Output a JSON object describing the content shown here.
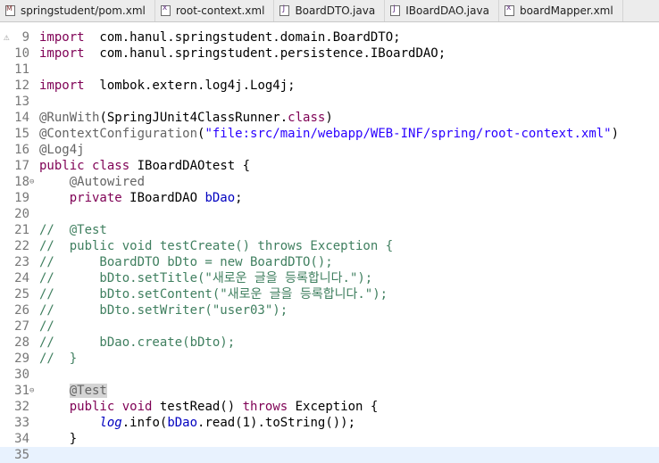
{
  "tabs": [
    {
      "label": "springstudent/pom.xml",
      "icon": "maven-pom-icon",
      "kind": "pom"
    },
    {
      "label": "root-context.xml",
      "icon": "xml-file-icon",
      "kind": "xml"
    },
    {
      "label": "BoardDTO.java",
      "icon": "java-file-icon",
      "kind": "java"
    },
    {
      "label": "IBoardDAO.java",
      "icon": "java-file-icon",
      "kind": "java"
    },
    {
      "label": "boardMapper.xml",
      "icon": "xml-file-icon",
      "kind": "xml"
    }
  ],
  "lines": [
    {
      "n": "9",
      "warn": true,
      "segs": [
        [
          "kw",
          "import"
        ],
        [
          "",
          "  com.hanul.springstudent.domain.BoardDTO;"
        ]
      ]
    },
    {
      "n": "10",
      "segs": [
        [
          "kw",
          "import"
        ],
        [
          "",
          "  com.hanul.springstudent.persistence.IBoardDAO;"
        ]
      ]
    },
    {
      "n": "11",
      "segs": []
    },
    {
      "n": "12",
      "segs": [
        [
          "kw",
          "import"
        ],
        [
          "",
          "  lombok.extern.log4j.Log4j;"
        ]
      ]
    },
    {
      "n": "13",
      "segs": []
    },
    {
      "n": "14",
      "segs": [
        [
          "an",
          "@RunWith"
        ],
        [
          "",
          "(SpringJUnit4ClassRunner."
        ],
        [
          "kw",
          "class"
        ],
        [
          "",
          ")"
        ]
      ]
    },
    {
      "n": "15",
      "segs": [
        [
          "an",
          "@ContextConfiguration"
        ],
        [
          "",
          "("
        ],
        [
          "st",
          "\"file:src/main/webapp/WEB-INF/spring/root-context.xml\""
        ],
        [
          "",
          ")"
        ]
      ]
    },
    {
      "n": "16",
      "segs": [
        [
          "an",
          "@Log4j"
        ]
      ]
    },
    {
      "n": "17",
      "segs": [
        [
          "kw",
          "public"
        ],
        [
          "",
          " "
        ],
        [
          "kw",
          "class"
        ],
        [
          "",
          " IBoardDAOtest {"
        ]
      ]
    },
    {
      "n": "18",
      "fold": true,
      "segs": [
        [
          "",
          "    "
        ],
        [
          "an",
          "@Autowired"
        ]
      ]
    },
    {
      "n": "19",
      "segs": [
        [
          "",
          "    "
        ],
        [
          "kw",
          "private"
        ],
        [
          "",
          " IBoardDAO "
        ],
        [
          "fd",
          "bDao"
        ],
        [
          "",
          ";"
        ]
      ]
    },
    {
      "n": "20",
      "segs": []
    },
    {
      "n": "21",
      "segs": [
        [
          "cm",
          "//  @Test"
        ]
      ]
    },
    {
      "n": "22",
      "segs": [
        [
          "cm",
          "//  public void testCreate() throws Exception {"
        ]
      ]
    },
    {
      "n": "23",
      "segs": [
        [
          "cm",
          "//      BoardDTO bDto = new BoardDTO();"
        ]
      ]
    },
    {
      "n": "24",
      "segs": [
        [
          "cm",
          "//      bDto.setTitle(\"새로운 글을 등록합니다.\");"
        ]
      ]
    },
    {
      "n": "25",
      "segs": [
        [
          "cm",
          "//      bDto.setContent(\"새로운 글을 등록합니다.\");"
        ]
      ]
    },
    {
      "n": "26",
      "segs": [
        [
          "cm",
          "//      bDto.setWriter(\"user03\");"
        ]
      ]
    },
    {
      "n": "27",
      "segs": [
        [
          "cm",
          "//"
        ]
      ]
    },
    {
      "n": "28",
      "segs": [
        [
          "cm",
          "//      bDao.create(bDto);"
        ]
      ]
    },
    {
      "n": "29",
      "segs": [
        [
          "cm",
          "//  }"
        ]
      ]
    },
    {
      "n": "30",
      "segs": []
    },
    {
      "n": "31",
      "fold": true,
      "segs": [
        [
          "",
          "    "
        ],
        [
          "an hl",
          "@Test"
        ]
      ]
    },
    {
      "n": "32",
      "segs": [
        [
          "",
          "    "
        ],
        [
          "kw",
          "public"
        ],
        [
          "",
          " "
        ],
        [
          "kw",
          "void"
        ],
        [
          "",
          " testRead() "
        ],
        [
          "kw",
          "throws"
        ],
        [
          "",
          " Exception {"
        ]
      ]
    },
    {
      "n": "33",
      "segs": [
        [
          "",
          "        "
        ],
        [
          "sf",
          "log"
        ],
        [
          "",
          ".info("
        ],
        [
          "fd",
          "bDao"
        ],
        [
          "",
          ".read(1).toString());"
        ]
      ]
    },
    {
      "n": "34",
      "segs": [
        [
          "",
          "    }"
        ]
      ]
    },
    {
      "n": "35",
      "current": true,
      "segs": []
    }
  ]
}
